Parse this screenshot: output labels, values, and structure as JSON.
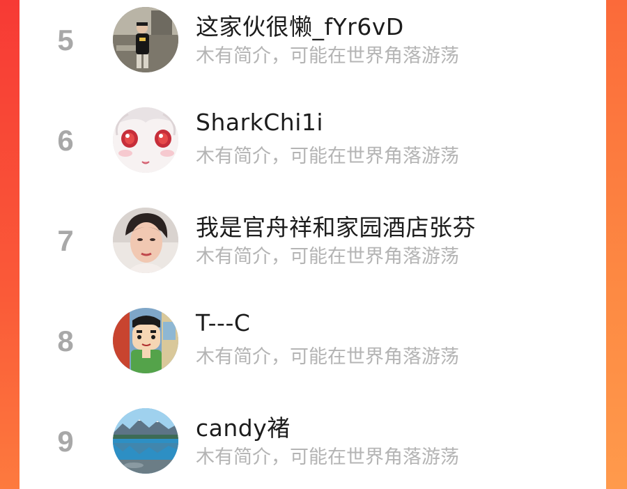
{
  "rankings": [
    {
      "rank": "5",
      "name": "这家伙很懒_fYr6vD",
      "intro": "木有简介，可能在世界角落游荡",
      "avatar_icon": "avatar-person-photo-icon"
    },
    {
      "rank": "6",
      "name": "SharkChi1i",
      "intro": "木有简介，可能在世界角落游荡",
      "avatar_icon": "avatar-anime-face-icon"
    },
    {
      "rank": "7",
      "name": "我是官舟祥和家园酒店张芬",
      "intro": "木有简介，可能在世界角落游荡",
      "avatar_icon": "avatar-woman-photo-icon"
    },
    {
      "rank": "8",
      "name": "T---C",
      "intro": "木有简介，可能在世界角落游荡",
      "avatar_icon": "avatar-cartoon-boy-icon"
    },
    {
      "rank": "9",
      "name": "candy褚",
      "intro": "木有简介，可能在世界角落游荡",
      "avatar_icon": "avatar-lake-landscape-icon"
    }
  ],
  "colors": {
    "background_accent": "#fb5a33",
    "card": "#ffffff",
    "rank_number": "#a8a8a8",
    "name_text": "#1c1c1c",
    "intro_text": "#b4b4b4"
  }
}
